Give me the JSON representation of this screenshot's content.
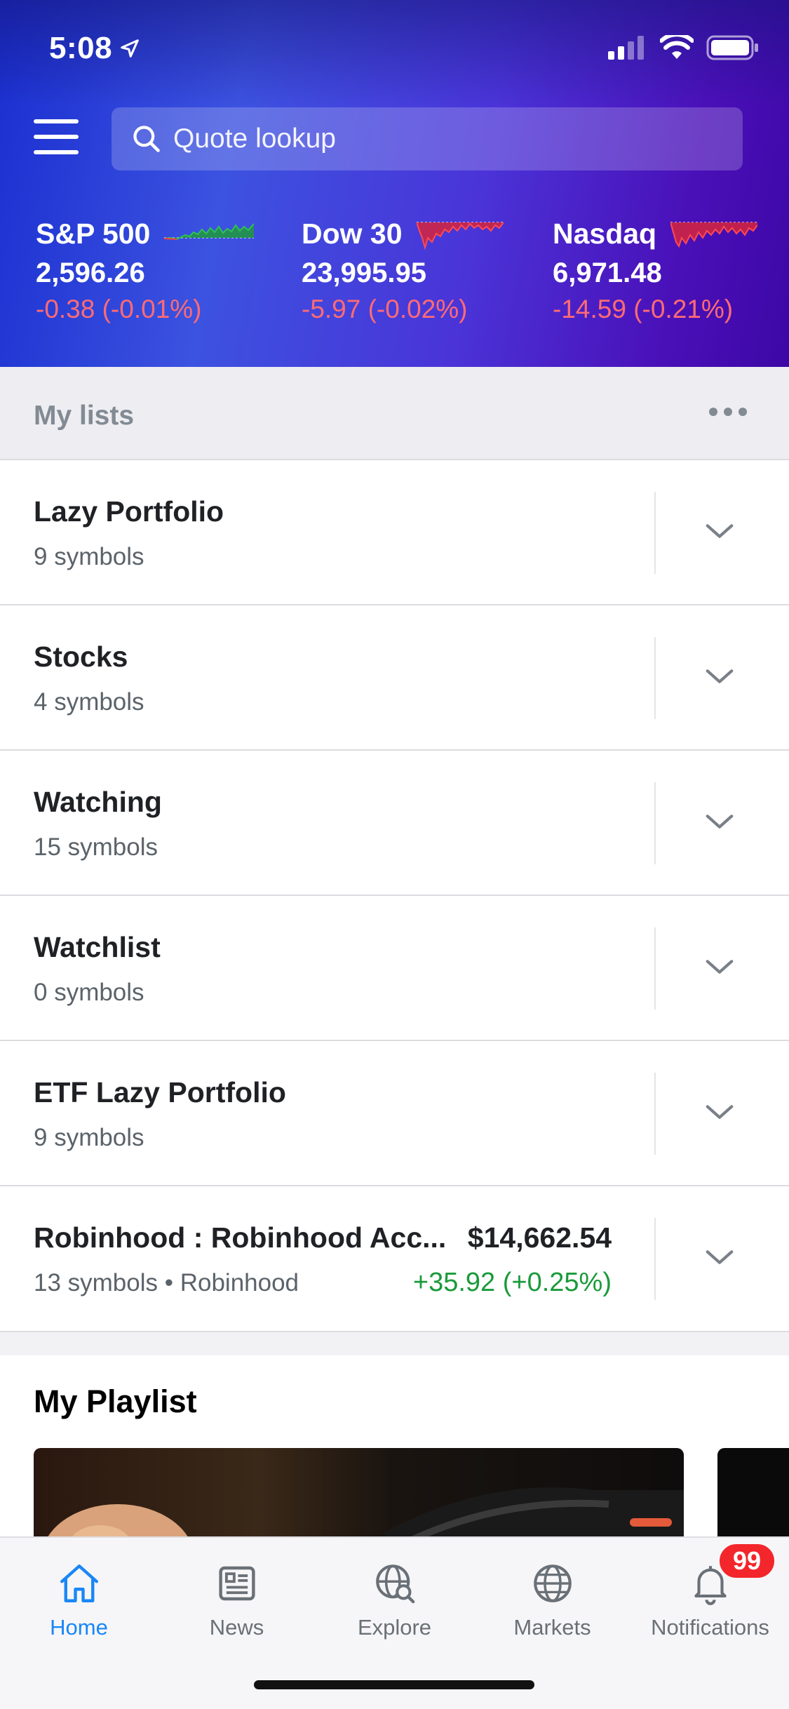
{
  "status_bar": {
    "time": "5:08"
  },
  "search": {
    "placeholder": "Quote lookup"
  },
  "indices": [
    {
      "name": "S&P 500",
      "value": "2,596.26",
      "change": "-0.38 (-0.01%)",
      "spark_color": "#1e9a3c"
    },
    {
      "name": "Dow 30",
      "value": "23,995.95",
      "change": "-5.97 (-0.02%)",
      "spark_color": "#ff3b42"
    },
    {
      "name": "Nasdaq",
      "value": "6,971.48",
      "change": "-14.59 (-0.21%)",
      "spark_color": "#ff3b42"
    }
  ],
  "lists": {
    "title": "My lists",
    "items": [
      {
        "name": "Lazy Portfolio",
        "sub": "9 symbols"
      },
      {
        "name": "Stocks",
        "sub": "4 symbols"
      },
      {
        "name": "Watching",
        "sub": "15 symbols"
      },
      {
        "name": "Watchlist",
        "sub": "0 symbols"
      },
      {
        "name": "ETF Lazy Portfolio",
        "sub": "9 symbols"
      },
      {
        "name": "Robinhood : Robinhood Acc...",
        "sub": "13 symbols • Robinhood",
        "value": "$14,662.54",
        "change": "+35.92 (+0.25%)"
      }
    ]
  },
  "playlist": {
    "title": "My Playlist"
  },
  "tabbar": {
    "home": "Home",
    "news": "News",
    "explore": "Explore",
    "markets": "Markets",
    "notifications": "Notifications",
    "badge": "99"
  },
  "colors": {
    "active_tab": "#1a87f5",
    "negative": "#ff6b74",
    "positive": "#1a9a3a"
  }
}
